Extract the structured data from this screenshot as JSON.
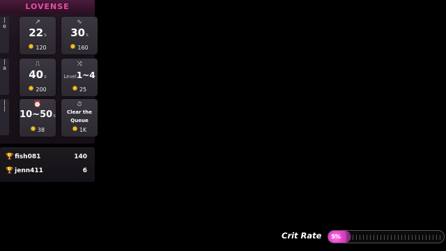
{
  "brand": "LOVENSE",
  "side_strip": [
    "|",
    "e",
    "|",
    "a",
    "|",
    "|"
  ],
  "tiles": [
    {
      "icon": "↗",
      "value": "22",
      "unit": "s",
      "cost": "120"
    },
    {
      "icon": "∿",
      "value": "30",
      "unit": "s",
      "cost": "160"
    },
    {
      "icon": "⎍",
      "value": "40",
      "unit": "s",
      "cost": "200"
    },
    {
      "icon": "⤨",
      "level_label": "Level",
      "value": "1~4",
      "cost": "25"
    },
    {
      "icon": "⏰",
      "value": "10~50",
      "unit": "s",
      "cost": "38"
    },
    {
      "icon": "⏱",
      "line1": "Clear the",
      "line2": "Queue",
      "cost": "1K"
    }
  ],
  "leaderboard": [
    {
      "name": "fish081",
      "score": "140"
    },
    {
      "name": "jenn411",
      "score": "6"
    }
  ],
  "crit": {
    "label": "Crit Rate",
    "value": "5%",
    "fill_fraction": 0.2
  }
}
